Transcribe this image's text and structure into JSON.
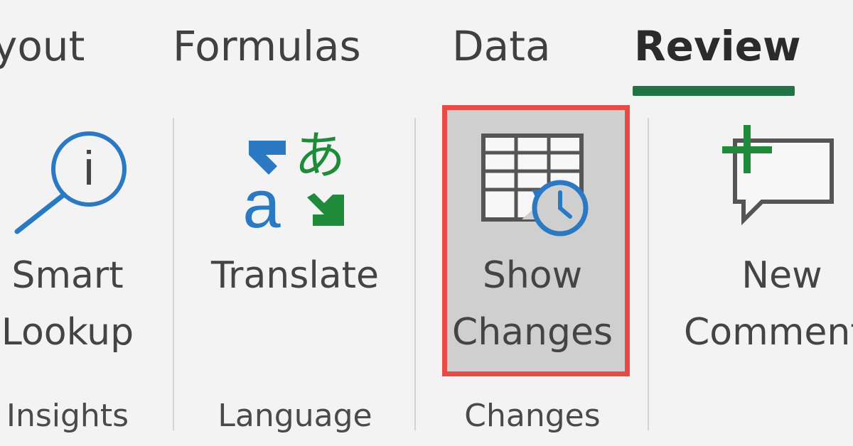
{
  "tabs": [
    {
      "label": "yout",
      "active": false
    },
    {
      "label": "Formulas",
      "active": false
    },
    {
      "label": "Data",
      "active": false
    },
    {
      "label": "Review",
      "active": true
    }
  ],
  "commands": {
    "smart_lookup": {
      "line1": "Smart",
      "line2": "Lookup",
      "icon": "search-info-icon"
    },
    "translate": {
      "line1": "Translate",
      "icon": "translate-icon"
    },
    "show_changes": {
      "line1": "Show",
      "line2": "Changes",
      "icon": "show-changes-icon",
      "highlighted": true
    },
    "new_comment": {
      "line1": "New",
      "line2": "Comment",
      "icon": "new-comment-icon"
    }
  },
  "groups": {
    "insights": "Insights",
    "language": "Language",
    "changes": "Changes"
  },
  "icon_glyphs": {
    "translate_a": "a",
    "translate_hiragana": "あ",
    "info_i": "i"
  },
  "colors": {
    "accent": "#217346",
    "highlight_border": "#e64c45",
    "icon_blue": "#2b79c2",
    "icon_green": "#1e8a3a",
    "background": "#f3f3f3"
  }
}
